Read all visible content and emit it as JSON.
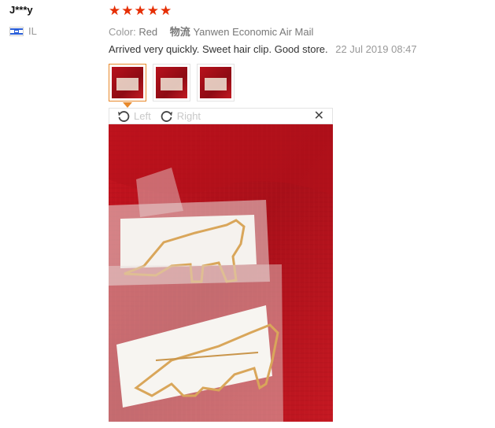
{
  "reviewer": {
    "name": "J***y",
    "country_code": "IL"
  },
  "rating": {
    "stars": 5,
    "max": 5,
    "color": "#e62e04"
  },
  "meta": {
    "color_label": "Color:",
    "color_value": "Red",
    "shipping_label": "物流",
    "shipping_value": "Yanwen Economic Air Mail"
  },
  "review": {
    "text": "Arrived very quickly. Sweet hair clip. Good store.",
    "date": "22 Jul 2019 08:47"
  },
  "thumbnails": [
    {
      "name": "photo-thumbnail-1",
      "selected": true
    },
    {
      "name": "photo-thumbnail-2",
      "selected": false
    },
    {
      "name": "photo-thumbnail-3",
      "selected": false
    }
  ],
  "viewer": {
    "rotate_left_label": "Left",
    "rotate_right_label": "Right",
    "close_icon": "close-icon"
  },
  "colors": {
    "accent": "#e8892b",
    "muted_text": "#999999",
    "background_red": "#b8121c"
  }
}
